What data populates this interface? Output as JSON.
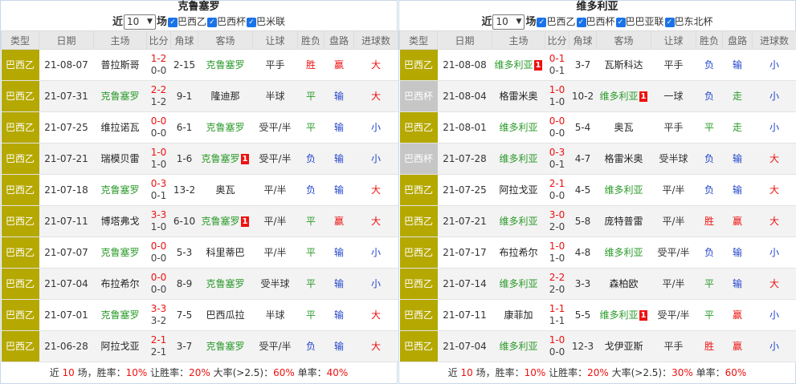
{
  "colors": {
    "league_bg": "#b5a800",
    "cup_bg": "#c6c6c6"
  },
  "header_labels": [
    "类型",
    "日期",
    "主场",
    "比分",
    "角球",
    "客场",
    "让球",
    "胜负",
    "盘路",
    "进球数"
  ],
  "left": {
    "team": "克鲁塞罗",
    "recent_prefix": "近",
    "count": "10",
    "recent_suffix": "场",
    "checkboxes": [
      "巴西乙",
      "巴西杯",
      "巴米联"
    ],
    "rows": [
      {
        "type": "巴西乙",
        "cup": false,
        "date": "21-08-07",
        "home": "普拉斯哥",
        "hc": "black",
        "hcard": "",
        "s1": "1-2",
        "s2": "0-0",
        "corner": "2-15",
        "away": "克鲁塞罗",
        "ac": "green",
        "acard": "",
        "hcp": "平手",
        "wl": "胜",
        "wlc": "red",
        "pan": "赢",
        "panc": "red",
        "goal": "大",
        "goalc": "red"
      },
      {
        "type": "巴西乙",
        "cup": false,
        "date": "21-07-31",
        "home": "克鲁塞罗",
        "hc": "green",
        "hcard": "",
        "s1": "2-2",
        "s2": "1-2",
        "corner": "9-1",
        "away": "隆迪那",
        "ac": "black",
        "acard": "",
        "hcp": "半球",
        "wl": "平",
        "wlc": "green",
        "pan": "输",
        "panc": "blue",
        "goal": "大",
        "goalc": "red"
      },
      {
        "type": "巴西乙",
        "cup": false,
        "date": "21-07-25",
        "home": "维拉诺瓦",
        "hc": "black",
        "hcard": "",
        "s1": "0-0",
        "s2": "0-0",
        "corner": "6-1",
        "away": "克鲁塞罗",
        "ac": "green",
        "acard": "",
        "hcp": "受平/半",
        "wl": "平",
        "wlc": "green",
        "pan": "输",
        "panc": "blue",
        "goal": "小",
        "goalc": "blue"
      },
      {
        "type": "巴西乙",
        "cup": false,
        "date": "21-07-21",
        "home": "瑞模贝雷",
        "hc": "black",
        "hcard": "",
        "s1": "1-0",
        "s2": "1-0",
        "corner": "1-6",
        "away": "克鲁塞罗",
        "ac": "green",
        "acard": "1",
        "hcp": "受平/半",
        "wl": "负",
        "wlc": "blue",
        "pan": "输",
        "panc": "blue",
        "goal": "小",
        "goalc": "blue"
      },
      {
        "type": "巴西乙",
        "cup": false,
        "date": "21-07-18",
        "home": "克鲁塞罗",
        "hc": "green",
        "hcard": "",
        "s1": "0-3",
        "s2": "0-1",
        "corner": "13-2",
        "away": "奥瓦",
        "ac": "black",
        "acard": "",
        "hcp": "平/半",
        "wl": "负",
        "wlc": "blue",
        "pan": "输",
        "panc": "blue",
        "goal": "大",
        "goalc": "red"
      },
      {
        "type": "巴西乙",
        "cup": false,
        "date": "21-07-11",
        "home": "博塔弗戈",
        "hc": "black",
        "hcard": "",
        "s1": "3-3",
        "s2": "1-0",
        "corner": "6-10",
        "away": "克鲁塞罗",
        "ac": "green",
        "acard": "1",
        "hcp": "平/半",
        "wl": "平",
        "wlc": "green",
        "pan": "赢",
        "panc": "red",
        "goal": "大",
        "goalc": "red"
      },
      {
        "type": "巴西乙",
        "cup": false,
        "date": "21-07-07",
        "home": "克鲁塞罗",
        "hc": "green",
        "hcard": "",
        "s1": "0-0",
        "s2": "0-0",
        "corner": "5-3",
        "away": "科里蒂巴",
        "ac": "black",
        "acard": "",
        "hcp": "平/半",
        "wl": "平",
        "wlc": "green",
        "pan": "输",
        "panc": "blue",
        "goal": "小",
        "goalc": "blue"
      },
      {
        "type": "巴西乙",
        "cup": false,
        "date": "21-07-04",
        "home": "布拉希尔",
        "hc": "black",
        "hcard": "",
        "s1": "0-0",
        "s2": "0-0",
        "corner": "8-9",
        "away": "克鲁塞罗",
        "ac": "green",
        "acard": "",
        "hcp": "受半球",
        "wl": "平",
        "wlc": "green",
        "pan": "输",
        "panc": "blue",
        "goal": "小",
        "goalc": "blue"
      },
      {
        "type": "巴西乙",
        "cup": false,
        "date": "21-07-01",
        "home": "克鲁塞罗",
        "hc": "green",
        "hcard": "",
        "s1": "3-3",
        "s2": "3-2",
        "corner": "7-5",
        "away": "巴西瓜拉",
        "ac": "black",
        "acard": "",
        "hcp": "半球",
        "wl": "平",
        "wlc": "green",
        "pan": "输",
        "panc": "blue",
        "goal": "大",
        "goalc": "red"
      },
      {
        "type": "巴西乙",
        "cup": false,
        "date": "21-06-28",
        "home": "阿拉戈亚",
        "hc": "black",
        "hcard": "",
        "s1": "2-1",
        "s2": "2-1",
        "corner": "3-7",
        "away": "克鲁塞罗",
        "ac": "green",
        "acard": "",
        "hcp": "受平/半",
        "wl": "负",
        "wlc": "blue",
        "pan": "输",
        "panc": "blue",
        "goal": "大",
        "goalc": "red"
      }
    ],
    "footer": {
      "p1": "近 ",
      "count": "10",
      "p2": " 场，胜率：",
      "win": "10%",
      "p3": " 让胜率：",
      "hwin": "20%",
      "p4": " 大率(>2.5)：",
      "big": "60%",
      "p5": " 单率：",
      "odd": "40%"
    }
  },
  "right": {
    "team": "维多利亚",
    "recent_prefix": "近",
    "count": "10",
    "recent_suffix": "场",
    "checkboxes": [
      "巴西乙",
      "巴西杯",
      "巴巴亚联",
      "巴东北杯"
    ],
    "rows": [
      {
        "type": "巴西乙",
        "cup": false,
        "date": "21-08-08",
        "home": "维多利亚",
        "hc": "green",
        "hcard": "1",
        "s1": "0-1",
        "s2": "0-1",
        "corner": "3-7",
        "away": "瓦斯科达",
        "ac": "black",
        "acard": "",
        "hcp": "平手",
        "wl": "负",
        "wlc": "blue",
        "pan": "输",
        "panc": "blue",
        "goal": "小",
        "goalc": "blue"
      },
      {
        "type": "巴西杯",
        "cup": true,
        "date": "21-08-04",
        "home": "格雷米奥",
        "hc": "black",
        "hcard": "",
        "s1": "1-0",
        "s2": "1-0",
        "corner": "10-2",
        "away": "维多利亚",
        "ac": "green",
        "acard": "1",
        "hcp": "一球",
        "wl": "负",
        "wlc": "blue",
        "pan": "走",
        "panc": "green",
        "goal": "小",
        "goalc": "blue"
      },
      {
        "type": "巴西乙",
        "cup": false,
        "date": "21-08-01",
        "home": "维多利亚",
        "hc": "green",
        "hcard": "",
        "s1": "0-0",
        "s2": "0-0",
        "corner": "5-4",
        "away": "奥瓦",
        "ac": "black",
        "acard": "",
        "hcp": "平手",
        "wl": "平",
        "wlc": "green",
        "pan": "走",
        "panc": "green",
        "goal": "小",
        "goalc": "blue"
      },
      {
        "type": "巴西杯",
        "cup": true,
        "date": "21-07-28",
        "home": "维多利亚",
        "hc": "green",
        "hcard": "",
        "s1": "0-3",
        "s2": "0-1",
        "corner": "4-7",
        "away": "格雷米奥",
        "ac": "black",
        "acard": "",
        "hcp": "受半球",
        "wl": "负",
        "wlc": "blue",
        "pan": "输",
        "panc": "blue",
        "goal": "大",
        "goalc": "red"
      },
      {
        "type": "巴西乙",
        "cup": false,
        "date": "21-07-25",
        "home": "阿拉戈亚",
        "hc": "black",
        "hcard": "",
        "s1": "2-1",
        "s2": "0-0",
        "corner": "4-5",
        "away": "维多利亚",
        "ac": "green",
        "acard": "",
        "hcp": "平/半",
        "wl": "负",
        "wlc": "blue",
        "pan": "输",
        "panc": "blue",
        "goal": "大",
        "goalc": "red"
      },
      {
        "type": "巴西乙",
        "cup": false,
        "date": "21-07-21",
        "home": "维多利亚",
        "hc": "green",
        "hcard": "",
        "s1": "3-0",
        "s2": "2-0",
        "corner": "5-8",
        "away": "庞特普雷",
        "ac": "black",
        "acard": "",
        "hcp": "平/半",
        "wl": "胜",
        "wlc": "red",
        "pan": "赢",
        "panc": "red",
        "goal": "大",
        "goalc": "red"
      },
      {
        "type": "巴西乙",
        "cup": false,
        "date": "21-07-17",
        "home": "布拉希尔",
        "hc": "black",
        "hcard": "",
        "s1": "1-0",
        "s2": "1-0",
        "corner": "4-8",
        "away": "维多利亚",
        "ac": "green",
        "acard": "",
        "hcp": "受平/半",
        "wl": "负",
        "wlc": "blue",
        "pan": "输",
        "panc": "blue",
        "goal": "小",
        "goalc": "blue"
      },
      {
        "type": "巴西乙",
        "cup": false,
        "date": "21-07-14",
        "home": "维多利亚",
        "hc": "green",
        "hcard": "",
        "s1": "2-2",
        "s2": "2-0",
        "corner": "3-3",
        "away": "森柏欧",
        "ac": "black",
        "acard": "",
        "hcp": "平/半",
        "wl": "平",
        "wlc": "green",
        "pan": "输",
        "panc": "blue",
        "goal": "大",
        "goalc": "red"
      },
      {
        "type": "巴西乙",
        "cup": false,
        "date": "21-07-11",
        "home": "康菲加",
        "hc": "black",
        "hcard": "",
        "s1": "1-1",
        "s2": "1-1",
        "corner": "5-5",
        "away": "维多利亚",
        "ac": "green",
        "acard": "1",
        "hcp": "受平/半",
        "wl": "平",
        "wlc": "green",
        "pan": "赢",
        "panc": "red",
        "goal": "小",
        "goalc": "blue"
      },
      {
        "type": "巴西乙",
        "cup": false,
        "date": "21-07-04",
        "home": "维多利亚",
        "hc": "green",
        "hcard": "",
        "s1": "1-0",
        "s2": "0-0",
        "corner": "12-3",
        "away": "戈伊亚斯",
        "ac": "black",
        "acard": "",
        "hcp": "平手",
        "wl": "胜",
        "wlc": "red",
        "pan": "赢",
        "panc": "red",
        "goal": "小",
        "goalc": "blue"
      }
    ],
    "footer": {
      "p1": "近 ",
      "count": "10",
      "p2": " 场，胜率：",
      "win": "10%",
      "p3": " 让胜率：",
      "hwin": "20%",
      "p4": " 大率(>2.5)：",
      "big": "30%",
      "p5": " 单率：",
      "odd": "60%"
    }
  }
}
